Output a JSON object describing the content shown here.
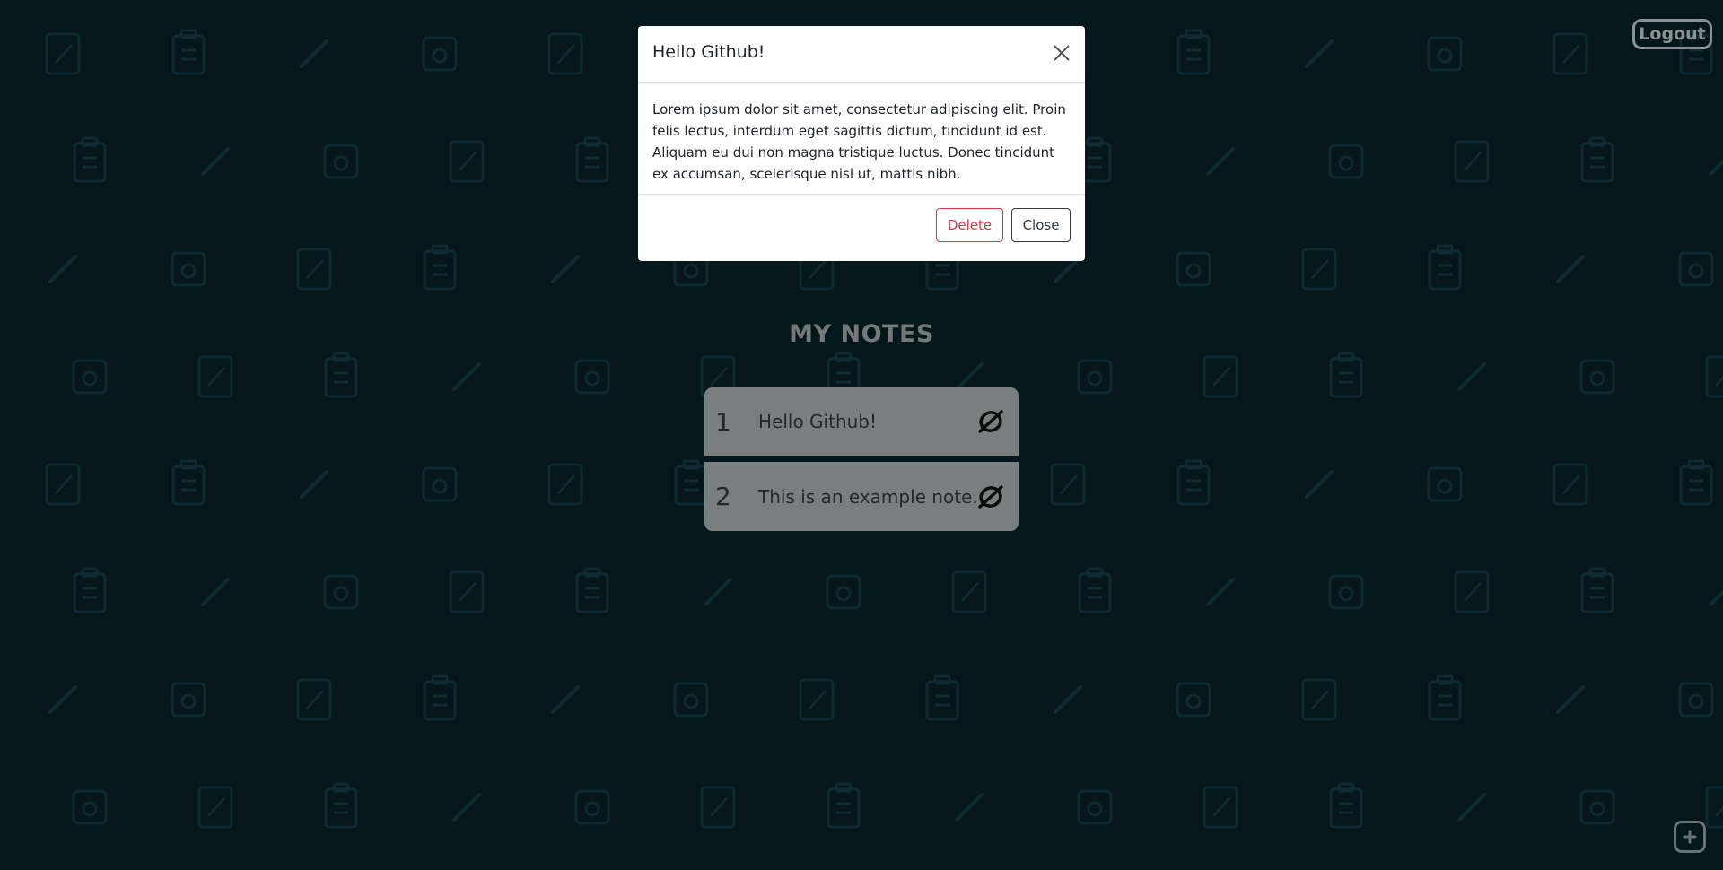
{
  "header": {
    "logout_label": "Logout"
  },
  "main": {
    "title": "MY NOTES",
    "notes": [
      {
        "number": "1",
        "text": "Hello Github!",
        "icon": "refresh-icon"
      },
      {
        "number": "2",
        "text": "This is an example note.",
        "icon": "refresh-icon"
      }
    ]
  },
  "fab": {
    "icon": "plus-icon"
  },
  "modal": {
    "title": "Hello Github!",
    "body": "Lorem ipsum dolor sit amet, consectetur adipiscing elit. Proin felis lectus, interdum eget sagittis dictum, tincidunt id est. Aliquam eu dui non magna tristique luctus. Donec tincidunt ex accumsan, scelerisque nisl ut, mattis nibh.",
    "delete_label": "Delete",
    "close_label": "Close",
    "close_icon": "close-icon"
  },
  "colors": {
    "background": "#06171b",
    "note_bg": "#7b7e7e",
    "danger": "#dc3545",
    "dark": "#343a40"
  }
}
